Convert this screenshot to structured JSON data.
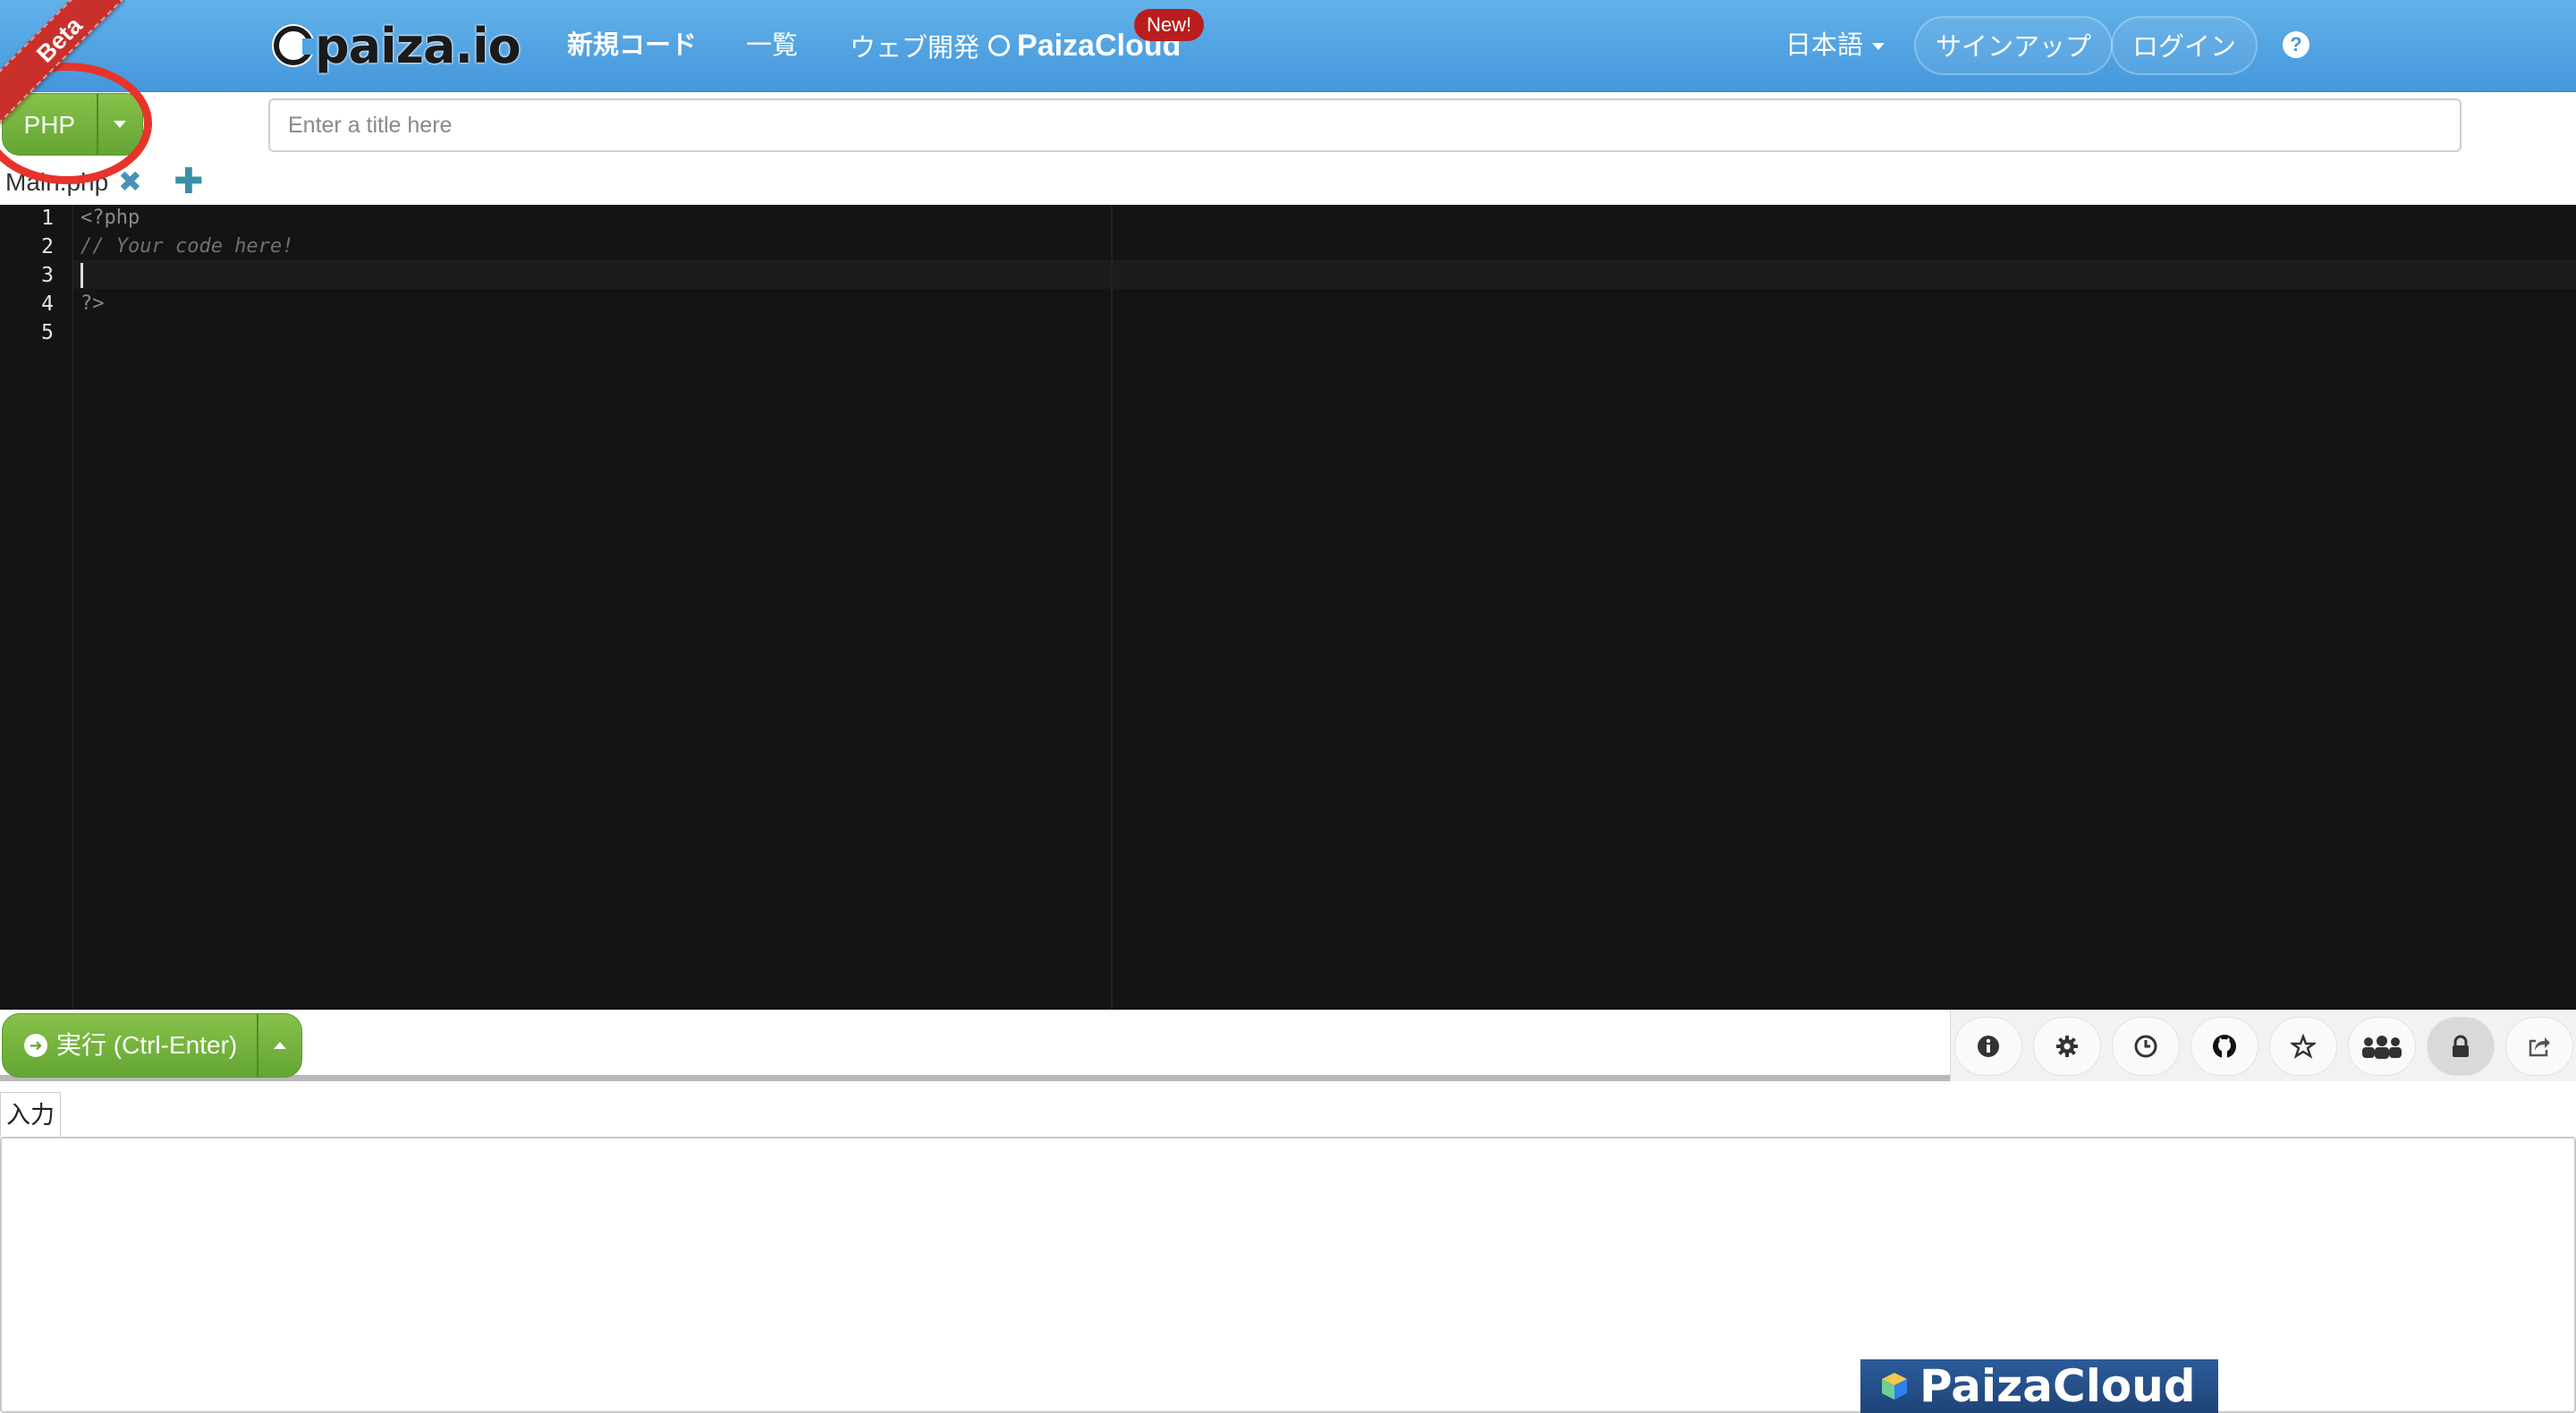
{
  "header": {
    "beta_label": "Beta",
    "logo_text": "paiza.io",
    "nav": {
      "new_code": "新規コード",
      "list": "一覧",
      "web_dev": "ウェブ開発",
      "cloud_brand": "PaizaCloud",
      "new_badge": "New!"
    },
    "language_selector": "日本語",
    "signup": "サインアップ",
    "login": "ログイン",
    "help_icon": "?"
  },
  "toolbar": {
    "language": "PHP",
    "title_placeholder": "Enter a title here",
    "title_value": ""
  },
  "tabs": {
    "files": [
      {
        "name": "Main.php"
      }
    ],
    "close_icon": "✖",
    "add_icon": "✚"
  },
  "editor": {
    "line_numbers": [
      "1",
      "2",
      "3",
      "4",
      "5"
    ],
    "lines": [
      "<?php",
      "// Your code here!",
      "",
      "?>",
      ""
    ]
  },
  "runbar": {
    "run_label": "実行 (Ctrl-Enter)",
    "tools": [
      "info-icon",
      "gear-icon",
      "clock-icon",
      "github-icon",
      "star-icon",
      "users-icon",
      "lock-icon",
      "share-icon"
    ]
  },
  "input_panel": {
    "tab_label": "入力",
    "value": ""
  },
  "banner": {
    "text": "PaizaCloud"
  },
  "colors": {
    "header_blue": "#4597db",
    "button_green": "#64a533",
    "annotation_red": "#e8332a",
    "editor_bg": "#141414",
    "badge_red": "#b91d1d"
  }
}
